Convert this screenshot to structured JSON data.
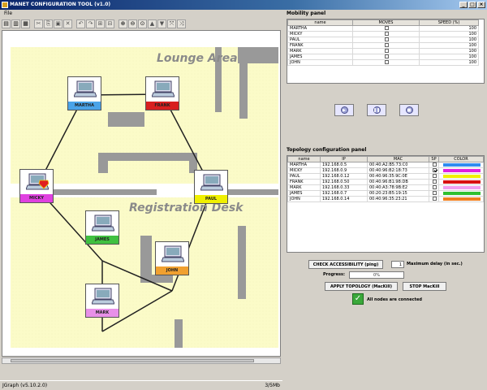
{
  "window": {
    "title": "MANET CONFIGURATION TOOL (v1.0)"
  },
  "menu": {
    "items": [
      "File"
    ]
  },
  "canvas": {
    "area_labels": {
      "lounge": "Lounge Area",
      "registration": "Registration Desk"
    },
    "nodes": {
      "martha": "MARTHA",
      "frank": "FRANK",
      "micky": "MICKY",
      "paul": "PAUL",
      "james": "JAMES",
      "john": "JOHN",
      "mark": "MARK"
    },
    "colors": {
      "martha": "#4aa3e8",
      "frank": "#d81f1f",
      "micky": "#e040e0",
      "paul": "#f0f000",
      "james": "#40c040",
      "john": "#f0a030",
      "mark": "#e890e8"
    }
  },
  "status": {
    "left": "JGraph (v5.10.2.0)",
    "right": "3/5Mb"
  },
  "mobility": {
    "title": "Mobility panel",
    "headers": [
      "name",
      "MOVES",
      "SPEED (%)"
    ],
    "rows": [
      {
        "name": "MARTHA",
        "moves": false,
        "speed": "100"
      },
      {
        "name": "MICKY",
        "moves": false,
        "speed": "100"
      },
      {
        "name": "PAUL",
        "moves": false,
        "speed": "100"
      },
      {
        "name": "FRANK",
        "moves": false,
        "speed": "100"
      },
      {
        "name": "MARK",
        "moves": false,
        "speed": "100"
      },
      {
        "name": "JAMES",
        "moves": false,
        "speed": "100"
      },
      {
        "name": "JOHN",
        "moves": false,
        "speed": "100"
      }
    ]
  },
  "topology": {
    "title": "Topology configuration panel",
    "headers": [
      "name",
      "IP",
      "MAC",
      "SP",
      "COLOR"
    ],
    "rows": [
      {
        "name": "MARTHA",
        "ip": "192.168.0.5",
        "mac": "00:40:A2:B5:73:C0",
        "sp": false,
        "color": "#2f8cf0"
      },
      {
        "name": "MICKY",
        "ip": "192.168.0.9",
        "mac": "00:40:96:B2:18:73",
        "sp": true,
        "color": "#e020e0"
      },
      {
        "name": "PAUL",
        "ip": "192.168.0.12",
        "mac": "00:40:96:35:9C:0E",
        "sp": false,
        "color": "#f0f000"
      },
      {
        "name": "FRANK",
        "ip": "192.168.0.50",
        "mac": "00:40:96:B1:98:DB",
        "sp": false,
        "color": "#d81010"
      },
      {
        "name": "MARK",
        "ip": "192.168.0.33",
        "mac": "00:40:A3:78:9B:E2",
        "sp": false,
        "color": "#f0a0f0"
      },
      {
        "name": "JAMES",
        "ip": "192.168.0.7",
        "mac": "00:20:23:B5:19:15",
        "sp": false,
        "color": "#30c030"
      },
      {
        "name": "JOHN",
        "ip": "192.168.0.14",
        "mac": "00:40:96:35:23:21",
        "sp": false,
        "color": "#f08020"
      }
    ]
  },
  "bottom": {
    "check_btn": "CHECK ACCESSIBILITY (ping)",
    "delay_value": "1",
    "delay_label": "Maximum delay (in sec.)",
    "progress_label": "Progress:",
    "progress_text": "0%",
    "progress": 0,
    "apply_btn": "APPLY TOPOLOGY (MacKill)",
    "stop_btn": "STOP MacKill",
    "status_msg": "All nodes are connected"
  }
}
